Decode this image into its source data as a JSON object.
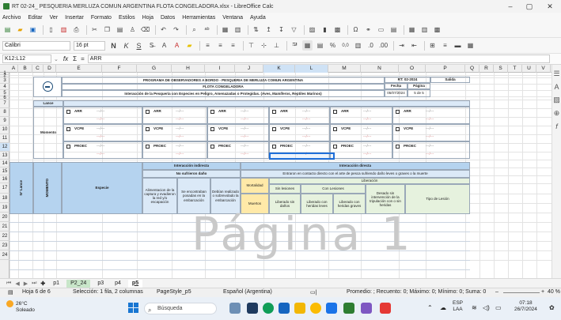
{
  "window": {
    "title": "RT 02-24_ PESQUERIA MERLUZA COMUN ARGENTINA FLOTA CONGELADORA.xlsx - LibreOffice Calc",
    "minimize": "–",
    "maximize": "▢",
    "close": "✕"
  },
  "menu": [
    "Archivo",
    "Editar",
    "Ver",
    "Insertar",
    "Formato",
    "Estilos",
    "Hoja",
    "Datos",
    "Herramientas",
    "Ventana",
    "Ayuda"
  ],
  "toolbar": {
    "font_name": "Calibri",
    "font_size": "16 pt",
    "bold": "N",
    "italic": "K",
    "underline": "S",
    "percent": "%",
    "decimals": "0,0"
  },
  "formula_bar": {
    "name_box": "K12:L12",
    "fx": "fx",
    "sum": "Σ",
    "eq": "=",
    "content": "ARR"
  },
  "columns": [
    "A",
    "B",
    "C",
    "D",
    "E",
    "F",
    "G",
    "H",
    "I",
    "J",
    "K",
    "L",
    "M",
    "N",
    "O",
    "P",
    "Q",
    "R",
    "S",
    "T",
    "U",
    "V"
  ],
  "selected_columns": [
    "K",
    "L"
  ],
  "rows": [
    "1",
    "2",
    "3",
    "4",
    "5",
    "6",
    "7",
    "8",
    "9",
    "10",
    "11",
    "12",
    "13",
    "14",
    "15",
    "16",
    "17",
    "18",
    "19",
    "20",
    "21",
    "22",
    "23",
    "24"
  ],
  "selected_row": "12",
  "form": {
    "title": "PROGRAMA DE OBSERVADORES A BORDO - PESQUERIA DE MERLUZA COMUN ARGENTINA",
    "subtitle": "FLOTA CONGELADORA",
    "heading": "Interacción de la Pesquería con Especies en Peligro, Amenazadas o Protegidas. (Aves, Mamíferos, Reptiles Marinos)",
    "ref_code": "RT: 02-2024",
    "ref_label": "Salida",
    "fecha_label": "Fecha",
    "pagina_label": "Página",
    "fecha_value": "05/07/2024",
    "pagina_value": "5 de 5",
    "lance_label": "Lance",
    "momento_label": "Momento",
    "species_codes": [
      "ARR",
      "VCPE",
      "PROEC"
    ],
    "dash": "---/---",
    "interaccion_indirecta": "Interacción indirecta",
    "interaccion_directa": "Interacción directa",
    "no_sufrieron": "No sufrieron daño",
    "entraron_contacto": "Entraron en contacto directo con el arte de pesca sufriendo daño leves o graves o la muerte",
    "liberacion": "Liberación",
    "mortalidad": "Mortalidad",
    "sin_lesiones": "Sin lesiones",
    "con_lesiones": "Con Lesiones",
    "especie": "Especie",
    "n_lance": "N° Lance",
    "momento_vertical": "MOMENTO",
    "alimentacion": "Alimentacion de la captura y evadieron la red y/o escapación",
    "se_encontraban": "Se encontraban posadas en la embarcación",
    "debian_realizado": "Debían realizado o sobrevolado la embarcación",
    "muertos": "Muertos",
    "liberado_sin_daños": "Liberado sin daños",
    "liberado_leves": "Liberado con heridas leves",
    "liberado_graves": "Liberado con heridas graves",
    "desado_intervencion": "Desado sin intervención de la tripulación con o sin heridas",
    "tipo_lesion": "Tipo de Lesión"
  },
  "watermark": "Página 1",
  "sheet_tabs": [
    "p1",
    "P2_24",
    "p3",
    "p4",
    "p5"
  ],
  "active_tab": "p5",
  "status": {
    "sheet": "Hoja 6 de 6",
    "selection": "Selección: 1 fila, 2 columnas",
    "page_style": "PageStyle_p5",
    "language": "Español (Argentina)",
    "summary": "Promedio: ; Recuento: 0; Máximo: 0; Mínimo: 0; Suma: 0",
    "zoom": "40 %"
  },
  "taskbar": {
    "temp": "26°C",
    "weather": "Soleado",
    "search_placeholder": "Búsqueda",
    "lang_top": "ESP",
    "lang_bottom": "LAA",
    "time": "07:18",
    "date": "26/7/2024"
  }
}
